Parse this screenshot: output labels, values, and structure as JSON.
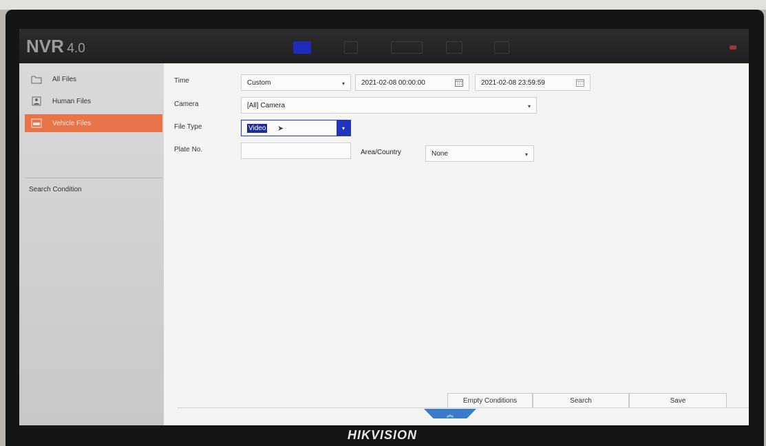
{
  "header": {
    "product": "NVR",
    "version": "4.0"
  },
  "sidebar": {
    "items": [
      {
        "label": "All Files",
        "icon": "folder-icon"
      },
      {
        "label": "Human Files",
        "icon": "person-icon"
      },
      {
        "label": "Vehicle Files",
        "icon": "vehicle-icon",
        "active": true
      }
    ],
    "search_condition": "Search Condition"
  },
  "form": {
    "time": {
      "label": "Time",
      "mode": "Custom",
      "start": "2021-02-08 00:00:00",
      "end": "2021-02-08 23:59:59"
    },
    "camera": {
      "label": "Camera",
      "value": "[All] Camera"
    },
    "file_type": {
      "label": "File Type",
      "value": "Video"
    },
    "plate_no": {
      "label": "Plate No.",
      "value": ""
    },
    "area_country": {
      "label": "Area/Country",
      "value": "None"
    }
  },
  "buttons": {
    "empty_conditions": "Empty Conditions",
    "search": "Search",
    "save": "Save"
  },
  "monitor_brand": "HIKVISION",
  "colors": {
    "accent_orange": "#e8744a",
    "active_blue": "#2233c0",
    "topbar": "#262628"
  }
}
